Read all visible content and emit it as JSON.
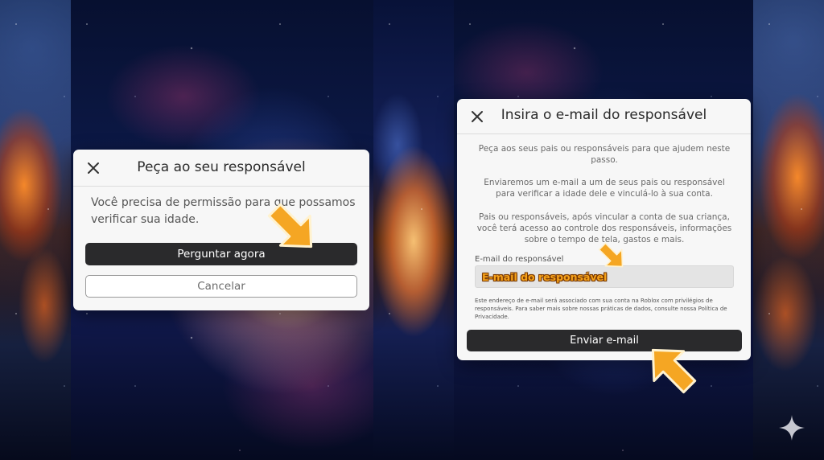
{
  "colors": {
    "accent_arrow": "#f5a623",
    "button_dark": "#2a2a2c",
    "dialog_bg": "#f7f7f7"
  },
  "left_dialog": {
    "title": "Peça ao seu responsável",
    "close_icon": "close-icon",
    "body": "Você precisa de permissão para que possamos verificar sua idade.",
    "primary_button": "Perguntar agora",
    "secondary_button": "Cancelar"
  },
  "right_dialog": {
    "title": "Insira o e-mail do responsável",
    "close_icon": "close-icon",
    "paragraph_1": "Peça aos seus pais ou responsáveis para que ajudem neste passo.",
    "paragraph_2": "Enviaremos um e-mail a um de seus pais ou responsável para verificar a idade dele e vinculá-lo à sua conta.",
    "paragraph_3": "Pais ou responsáveis, após vincular a conta de sua criança, você terá acesso ao controle dos responsáveis, informações sobre o tempo de tela, gastos e mais.",
    "email_label": "E-mail do responsável",
    "email_placeholder": "E-mail do responsável",
    "email_value": "",
    "fine_print": "Este endereço de e-mail será associado com sua conta na Roblox com privilégios de responsáveis. Para saber mais sobre nossas práticas de dados, consulte nossa Política de Privacidade.",
    "submit_button": "Enviar e-mail"
  },
  "decorations": {
    "arrow_icon": "pointer-arrow-icon",
    "sparkle_icon": "sparkle-icon"
  }
}
